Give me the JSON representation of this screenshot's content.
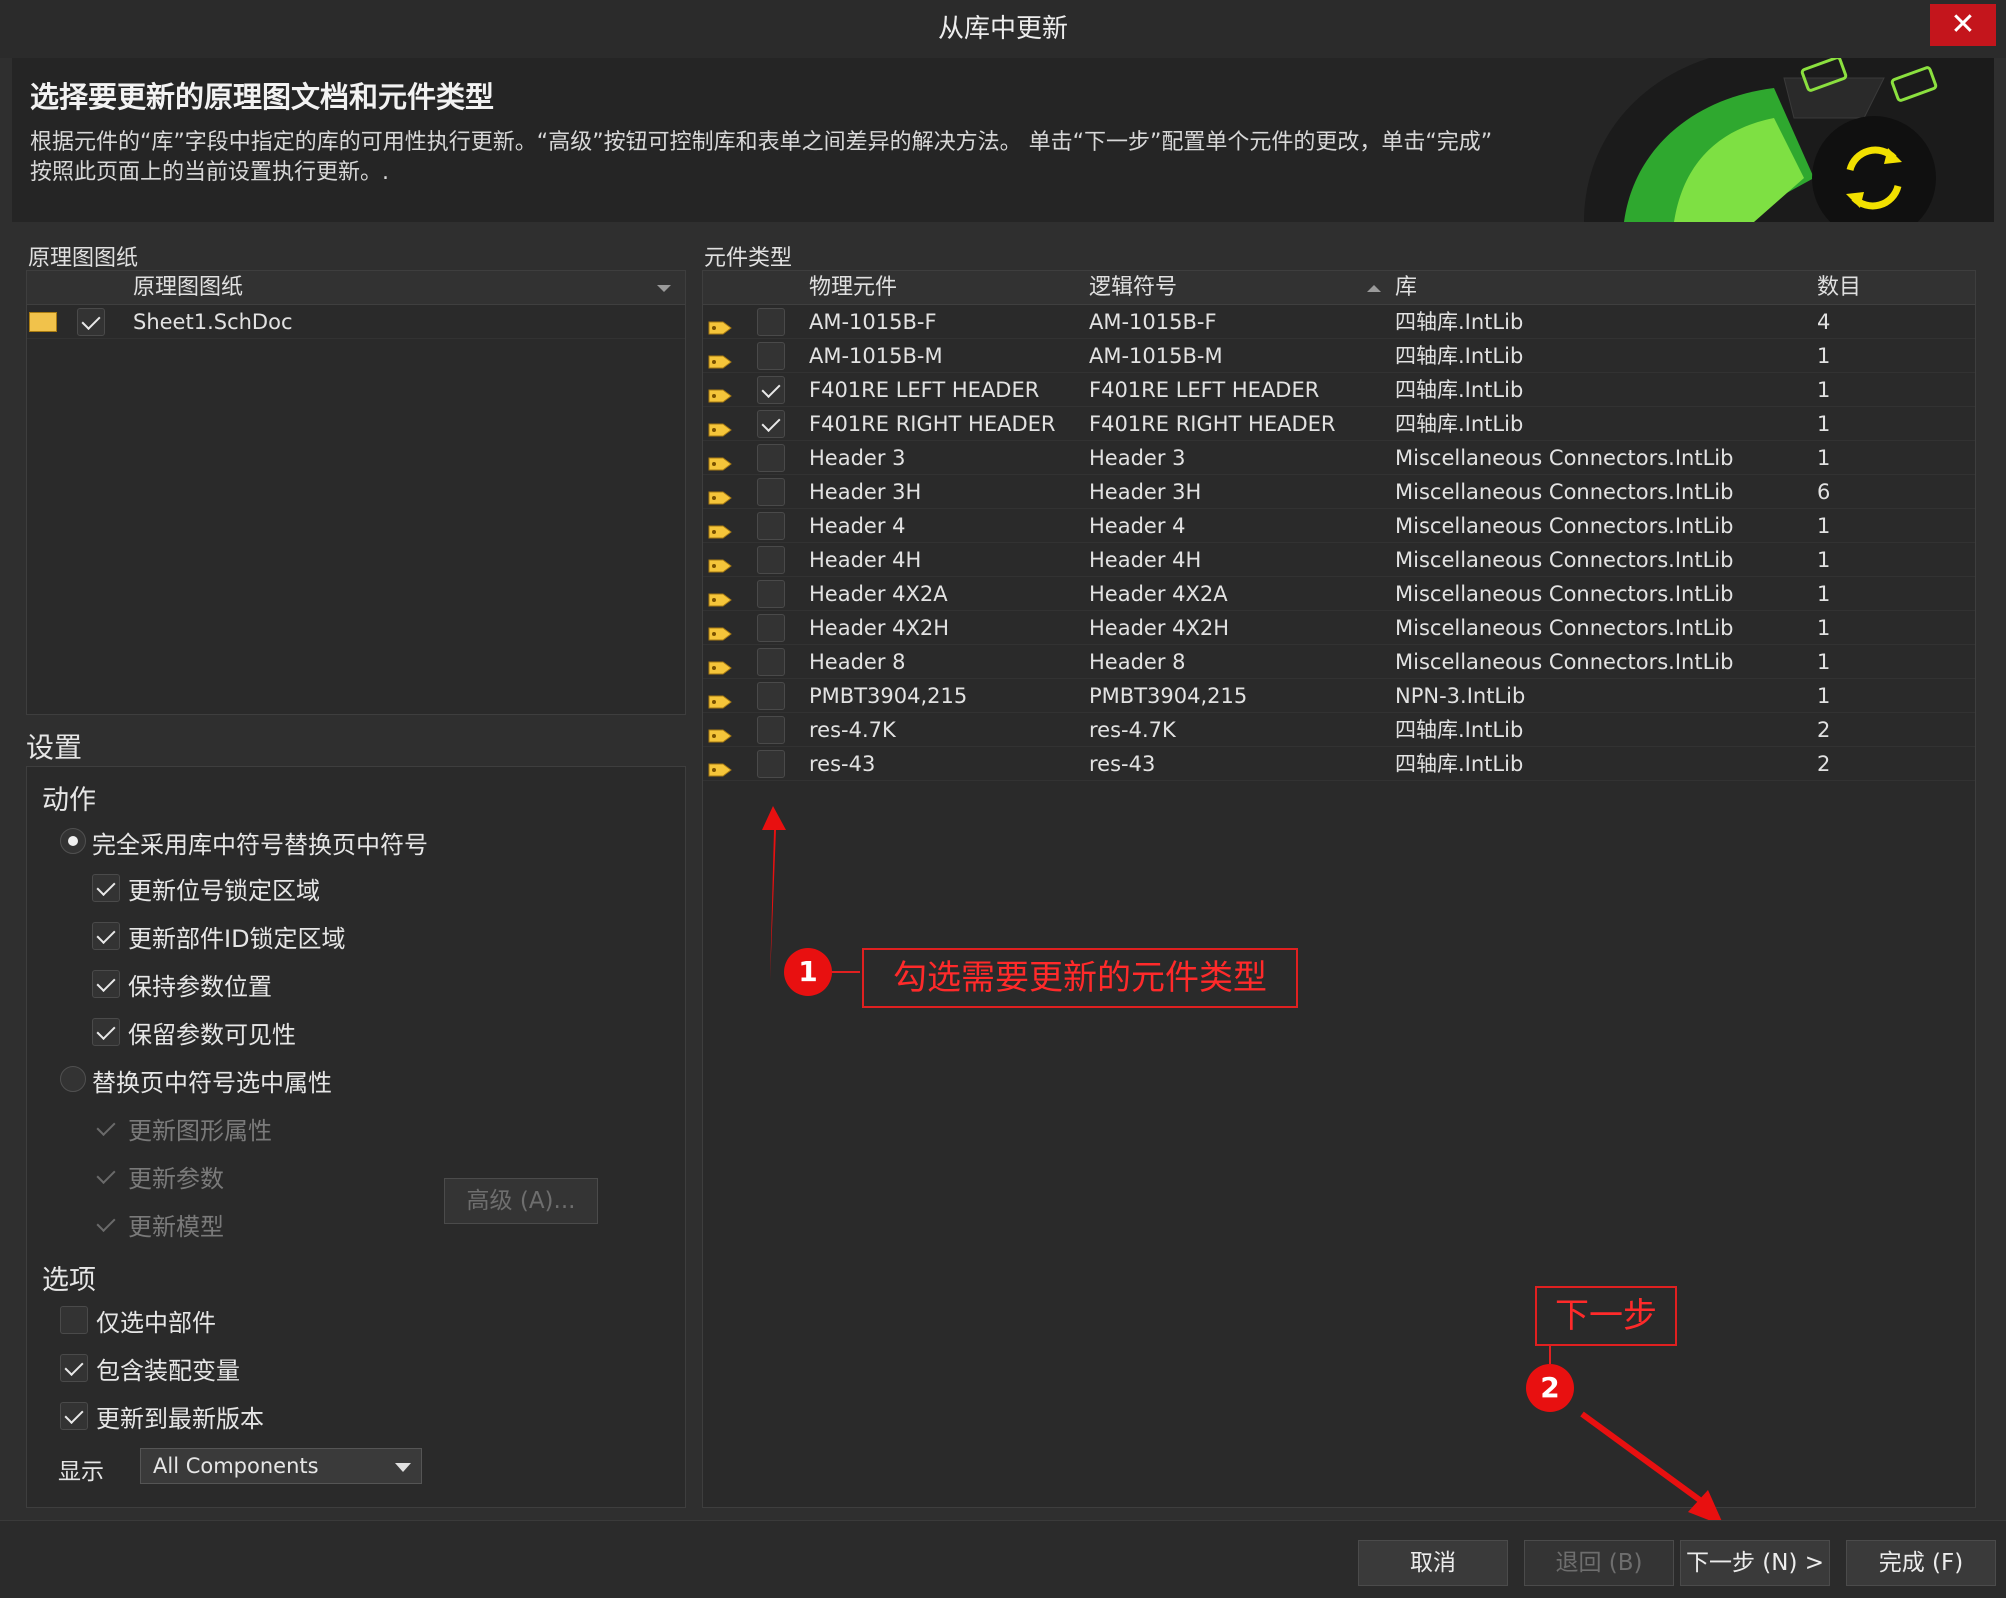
{
  "window": {
    "title": "从库中更新",
    "close": "✕"
  },
  "header": {
    "title": "选择要更新的原理图文档和元件类型",
    "desc1": "根据元件的“库”字段中指定的库的可用性执行更新。“高级”按钮可控制库和表单之间差异的解决方法。 单击“下一步”配置单个元件的更改，单击“完成”",
    "desc2": "按照此页面上的当前设置执行更新。."
  },
  "sheets": {
    "caption": "原理图图纸",
    "column": "原理图图纸",
    "items": [
      {
        "name": "Sheet1.SchDoc",
        "checked": true
      }
    ]
  },
  "components": {
    "caption": "元件类型",
    "columns": [
      "物理元件",
      "逻辑符号",
      "库",
      "数目"
    ],
    "rows": [
      {
        "phys": "AM-1015B-F",
        "logic": "AM-1015B-F",
        "lib": "四轴库.IntLib",
        "count": "4",
        "checked": false
      },
      {
        "phys": "AM-1015B-M",
        "logic": "AM-1015B-M",
        "lib": "四轴库.IntLib",
        "count": "1",
        "checked": false
      },
      {
        "phys": "F401RE LEFT HEADER",
        "logic": "F401RE LEFT HEADER",
        "lib": "四轴库.IntLib",
        "count": "1",
        "checked": true
      },
      {
        "phys": "F401RE RIGHT HEADER",
        "logic": "F401RE RIGHT HEADER",
        "lib": "四轴库.IntLib",
        "count": "1",
        "checked": true
      },
      {
        "phys": "Header 3",
        "logic": "Header 3",
        "lib": "Miscellaneous Connectors.IntLib",
        "count": "1",
        "checked": false
      },
      {
        "phys": "Header 3H",
        "logic": "Header 3H",
        "lib": "Miscellaneous Connectors.IntLib",
        "count": "6",
        "checked": false
      },
      {
        "phys": "Header 4",
        "logic": "Header 4",
        "lib": "Miscellaneous Connectors.IntLib",
        "count": "1",
        "checked": false
      },
      {
        "phys": "Header 4H",
        "logic": "Header 4H",
        "lib": "Miscellaneous Connectors.IntLib",
        "count": "1",
        "checked": false
      },
      {
        "phys": "Header 4X2A",
        "logic": "Header 4X2A",
        "lib": "Miscellaneous Connectors.IntLib",
        "count": "1",
        "checked": false
      },
      {
        "phys": "Header 4X2H",
        "logic": "Header 4X2H",
        "lib": "Miscellaneous Connectors.IntLib",
        "count": "1",
        "checked": false
      },
      {
        "phys": "Header 8",
        "logic": "Header 8",
        "lib": "Miscellaneous Connectors.IntLib",
        "count": "1",
        "checked": false
      },
      {
        "phys": "PMBT3904,215",
        "logic": "PMBT3904,215",
        "lib": "NPN-3.IntLib",
        "count": "1",
        "checked": false
      },
      {
        "phys": "res-4.7K",
        "logic": "res-4.7K",
        "lib": "四轴库.IntLib",
        "count": "2",
        "checked": false
      },
      {
        "phys": "res-43",
        "logic": "res-43",
        "lib": "四轴库.IntLib",
        "count": "2",
        "checked": false
      }
    ]
  },
  "settings": {
    "title": "设置",
    "action_title": "动作",
    "radio1": "完全采用库中符号替换页中符号",
    "r1_opts": [
      "更新位号锁定区域",
      "更新部件ID锁定区域",
      "保持参数位置",
      "保留参数可见性"
    ],
    "radio2": "替换页中符号选中属性",
    "r2_opts": [
      "更新图形属性",
      "更新参数",
      "更新模型"
    ],
    "advanced": "高级 (A)...",
    "options_title": "选项",
    "opts": [
      {
        "label": "仅选中部件",
        "checked": false
      },
      {
        "label": "包含装配变量",
        "checked": true
      },
      {
        "label": "更新到最新版本",
        "checked": true
      }
    ],
    "display_label": "显示",
    "display_value": "All Components"
  },
  "buttons": {
    "cancel": "取消",
    "back": "退回 (B)",
    "next": "下一步 (N) >",
    "finish": "完成 (F)"
  },
  "annotations": {
    "one_num": "1",
    "one_text": "勾选需要更新的元件类型",
    "two_num": "2",
    "two_text": "下一步"
  }
}
